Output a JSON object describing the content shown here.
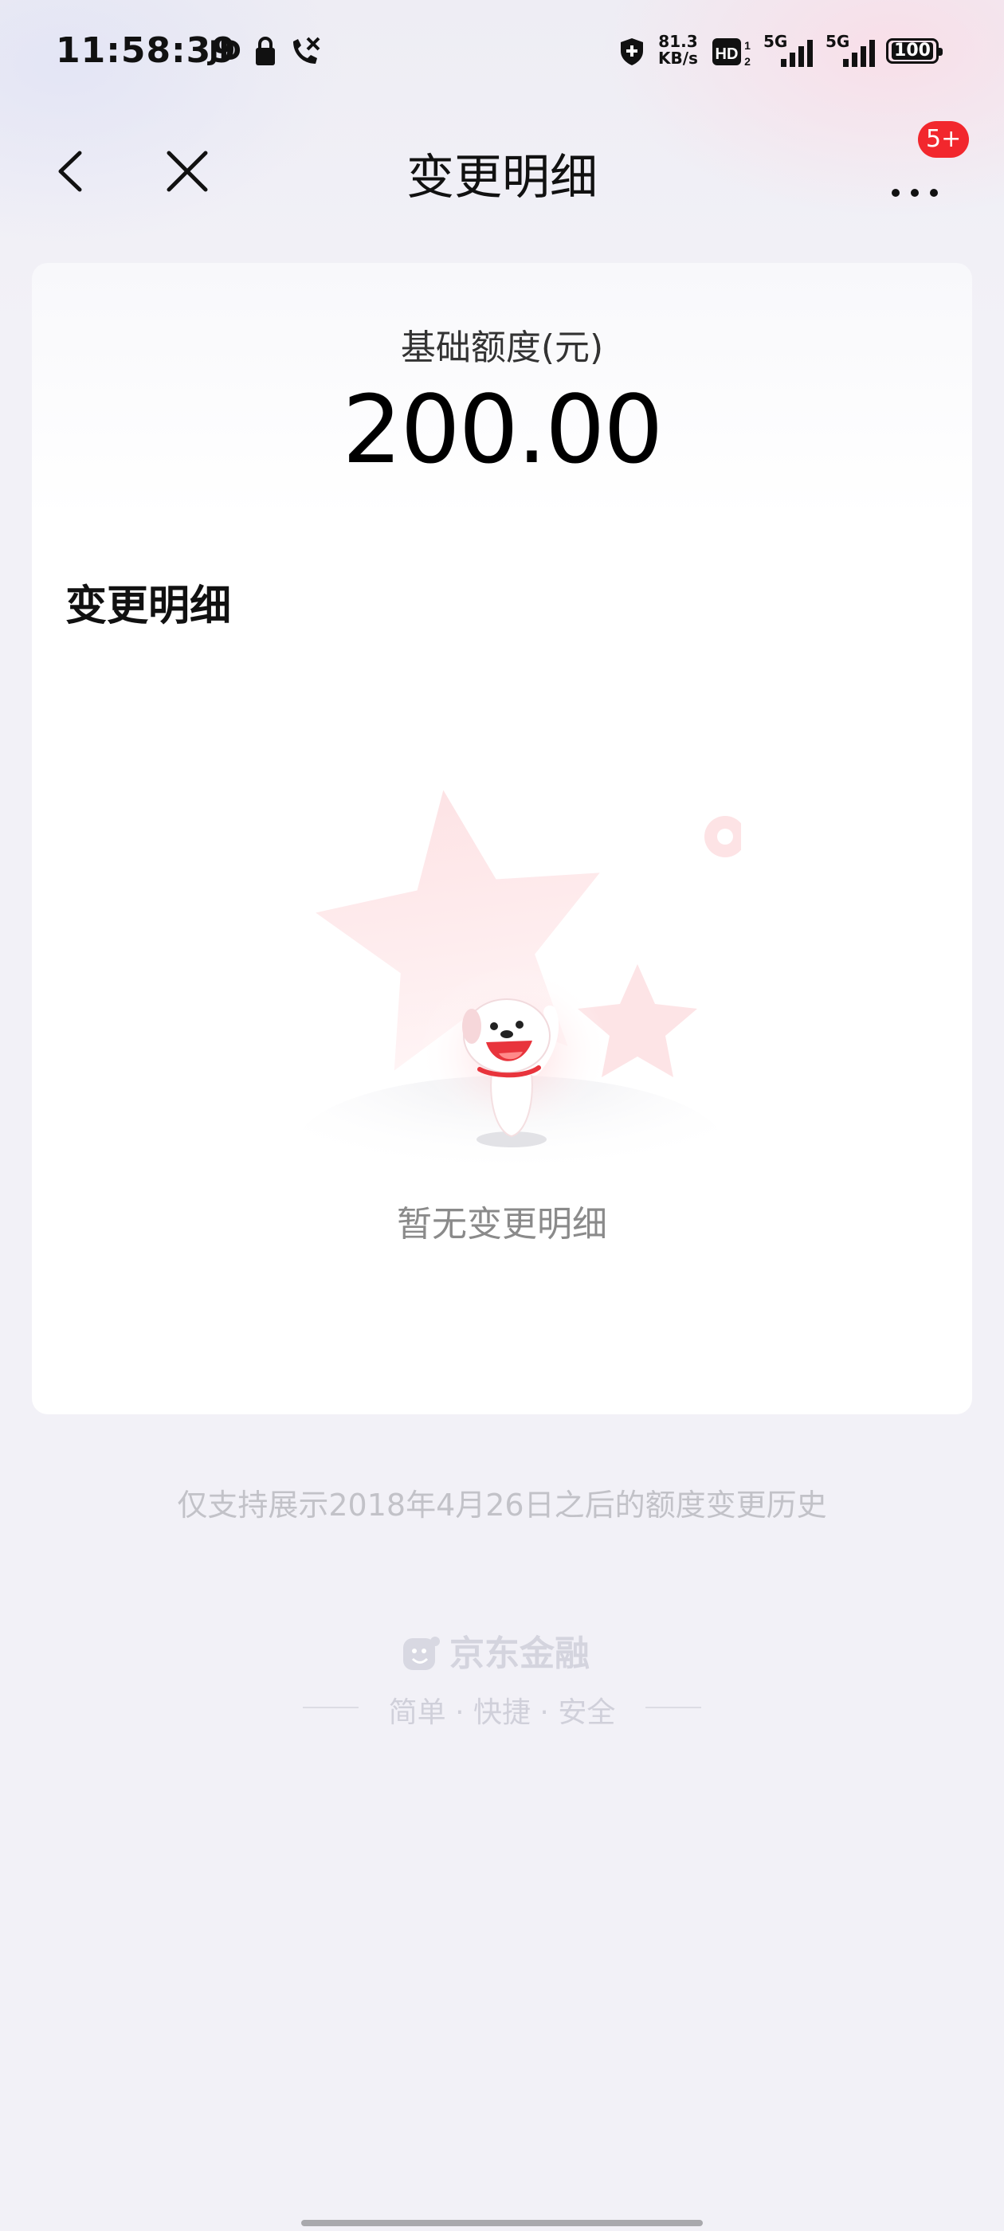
{
  "status_bar": {
    "time": "11:58:39",
    "carrier_app": "JD",
    "network_speed_value": "81.3",
    "network_speed_unit": "KB/s",
    "hd_label": "HD",
    "network_type_1": "5G",
    "network_type_2": "5G",
    "battery": "100"
  },
  "nav": {
    "title": "变更明细",
    "badge": "5+"
  },
  "card": {
    "credit_label": "基础额度(元)",
    "credit_value": "200.00",
    "section_title": "变更明细",
    "empty_text": "暂无变更明细"
  },
  "footer": {
    "note": "仅支持展示2018年4月26日之后的额度变更历史",
    "brand_name": "京东金融",
    "slogan": "简单 · 快捷 · 安全"
  },
  "colors": {
    "badge": "#f2272d",
    "background": "#f2f1f7",
    "card": "#ffffff"
  }
}
